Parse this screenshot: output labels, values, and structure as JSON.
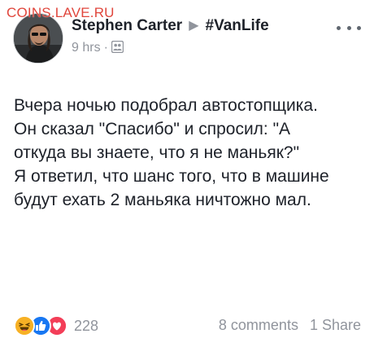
{
  "watermark": "COINS.LAVE.RU",
  "post": {
    "author": "Stephen Carter",
    "group": "#VanLife",
    "time": "9 hrs",
    "separator": "·",
    "audience_icon": "group-audience-icon",
    "text_lines": [
      "Вчера ночью подобрал автостопщика.",
      "Он сказал \"Спасибо\" и спросил: \"А",
      "откуда вы знаете, что я не маньяк?\"",
      "Я ответил, что шанс того, что в машине",
      "будут ехать 2 маньяка ничтожно мал."
    ]
  },
  "footer": {
    "reactions": [
      "haha",
      "like",
      "love"
    ],
    "reaction_count": "228",
    "comments": "8 comments",
    "shares": "1 Share"
  },
  "colors": {
    "text": "#1d2129",
    "secondary": "#90949c",
    "like": "#1877f2",
    "love": "#f33e58",
    "haha": "#f7b125",
    "watermark": "#e0463c"
  }
}
